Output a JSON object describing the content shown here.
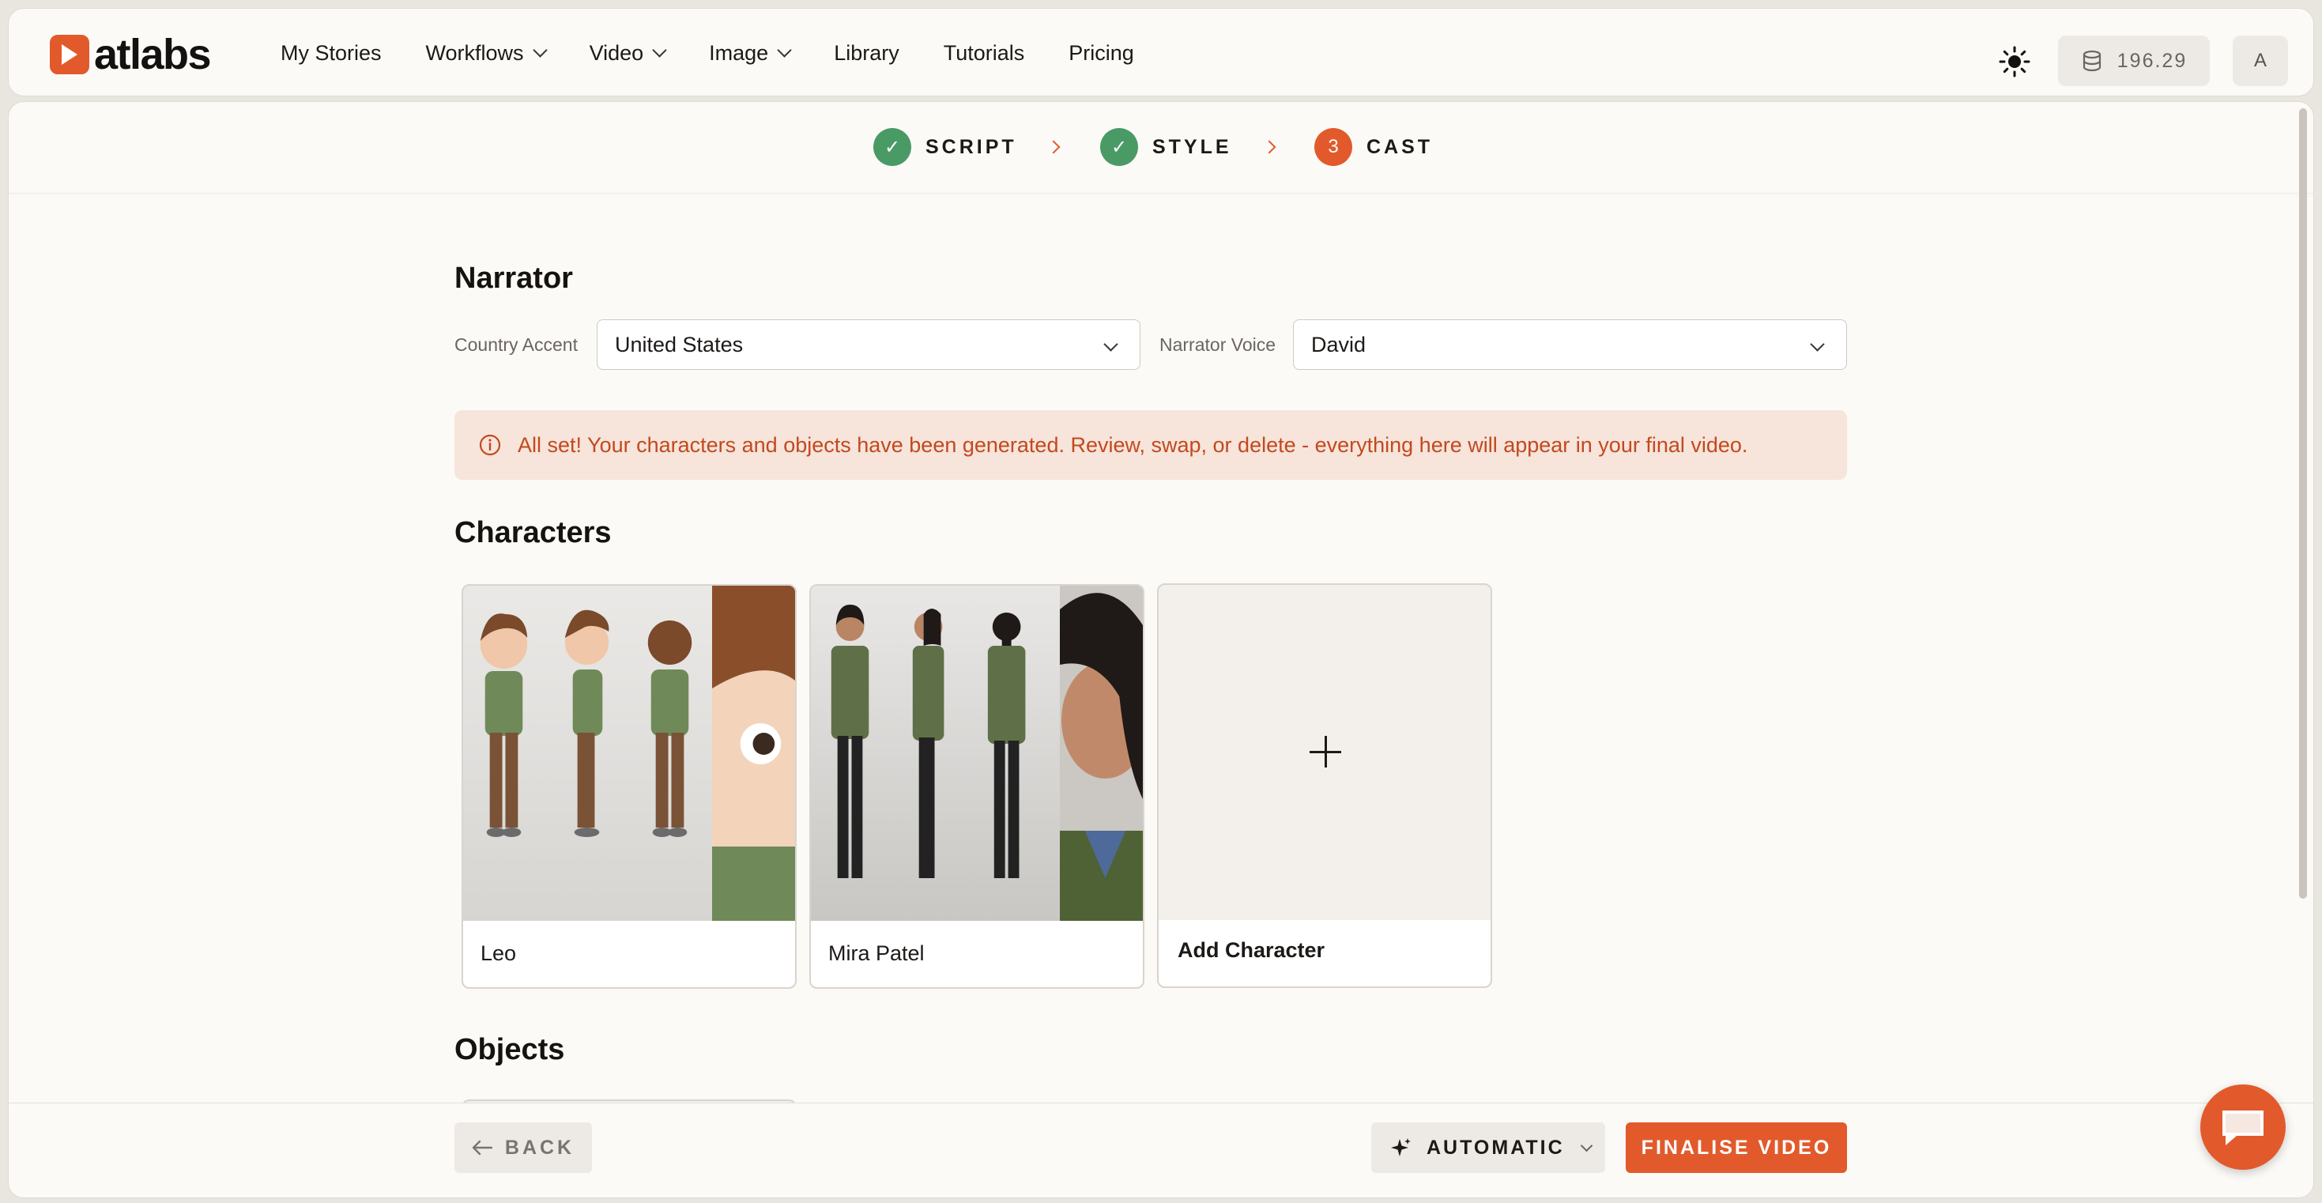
{
  "brand": {
    "name": "atlabs",
    "accent": "#e25a2b"
  },
  "nav": {
    "items": [
      {
        "label": "My Stories",
        "dropdown": false
      },
      {
        "label": "Workflows",
        "dropdown": true
      },
      {
        "label": "Video",
        "dropdown": true
      },
      {
        "label": "Image",
        "dropdown": true
      },
      {
        "label": "Library",
        "dropdown": false
      },
      {
        "label": "Tutorials",
        "dropdown": false
      },
      {
        "label": "Pricing",
        "dropdown": false
      }
    ],
    "theme_icon": "sun-icon",
    "credits": "196.29",
    "credits_icon": "database-icon",
    "avatar_initial": "A"
  },
  "steps": [
    {
      "label": "SCRIPT",
      "state": "done",
      "marker": "✓"
    },
    {
      "label": "STYLE",
      "state": "done",
      "marker": "✓"
    },
    {
      "label": "CAST",
      "state": "active",
      "marker": "3"
    }
  ],
  "narrator": {
    "heading": "Narrator",
    "accent_label": "Country Accent",
    "accent_value": "United States",
    "voice_label": "Narrator Voice",
    "voice_value": "David"
  },
  "notice": {
    "icon": "info-icon",
    "text": "All set! Your characters and objects have been generated. Review, swap, or delete - everything here will appear in your final video."
  },
  "characters": {
    "heading": "Characters",
    "items": [
      {
        "name": "Leo"
      },
      {
        "name": "Mira Patel"
      }
    ],
    "add_label": "Add Character"
  },
  "objects": {
    "heading": "Objects"
  },
  "footer": {
    "back_label": "BACK",
    "mode_label": "AUTOMATIC",
    "finalise_label": "FINALISE VIDEO"
  },
  "colors": {
    "done": "#4a9a66",
    "active": "#e25a2b",
    "notice_bg": "#f7e4da",
    "notice_text": "#c2491f"
  }
}
